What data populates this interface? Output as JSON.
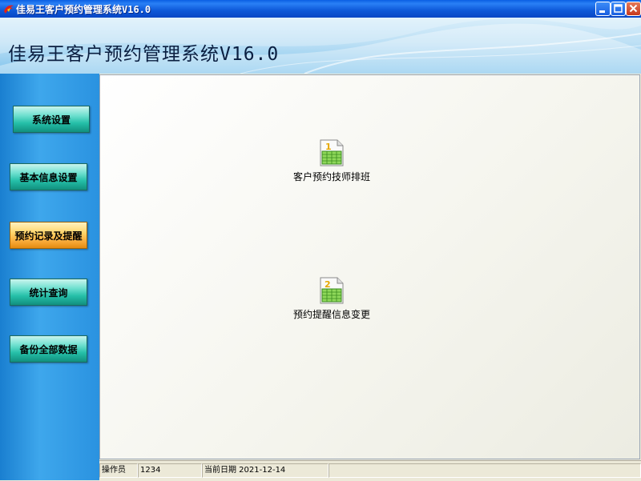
{
  "window": {
    "title": "佳易王客户预约管理系统V16.0",
    "icon": "app-logo-icon"
  },
  "banner": {
    "title": "佳易王客户预约管理系统V16.0"
  },
  "sidebar": {
    "items": [
      {
        "label": "系统设置",
        "active": false
      },
      {
        "label": "基本信息设置",
        "active": false
      },
      {
        "label": "预约记录及提醒",
        "active": true
      },
      {
        "label": "统计查询",
        "active": false
      },
      {
        "label": "备份全部数据",
        "active": false
      }
    ]
  },
  "main": {
    "shortcuts": [
      {
        "label": "客户预约技师排班",
        "icon": "spreadsheet-1-icon",
        "number": "1"
      },
      {
        "label": "预约提醒信息变更",
        "icon": "spreadsheet-2-icon",
        "number": "2"
      }
    ]
  },
  "status": {
    "operator_label": "操作员",
    "operator_value": "1234",
    "date_text": "当前日期 2021-12-14",
    "extra": ""
  },
  "colors": {
    "titlebar": "#0a5fe3",
    "sidebar": "#2a92e0",
    "nav_button": "#25bfa8",
    "nav_button_active": "#f7a938"
  }
}
